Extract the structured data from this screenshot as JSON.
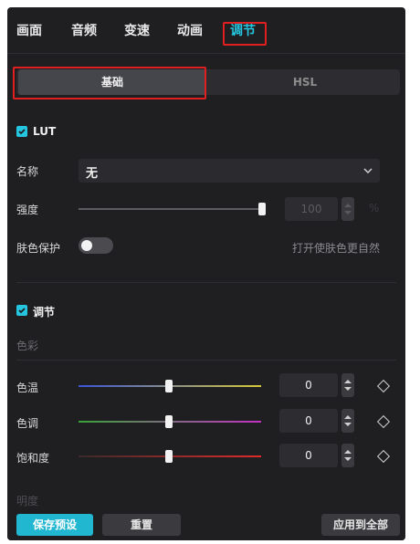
{
  "tabs": [
    {
      "label": "画面"
    },
    {
      "label": "音频"
    },
    {
      "label": "变速"
    },
    {
      "label": "动画"
    },
    {
      "label": "调节",
      "active": true
    }
  ],
  "subtabs": [
    {
      "label": "基础",
      "active": true
    },
    {
      "label": "HSL"
    }
  ],
  "lut": {
    "title": "LUT",
    "enabled": true,
    "name_label": "名称",
    "name_value": "无",
    "strength_label": "强度",
    "strength_value": "100",
    "strength_unit": "%",
    "strength_fraction": 1.0,
    "skin_protect_label": "肤色保护",
    "skin_protect_enabled": false,
    "skin_hint": "打开使肤色更自然"
  },
  "adjust": {
    "title": "调节",
    "enabled": true,
    "color_section": "色彩",
    "sliders": [
      {
        "label": "色温",
        "value": "0"
      },
      {
        "label": "色调",
        "value": "0"
      },
      {
        "label": "饱和度",
        "value": "0"
      }
    ],
    "next_section": "明度"
  },
  "footer": {
    "save_preset": "保存预设",
    "reset": "重置",
    "apply_all": "应用到全部"
  },
  "colors": {
    "accent": "#25c6e0",
    "highlight_box": "#e02020",
    "panel_bg": "#1f1f22"
  },
  "icons": [
    "check-icon",
    "chevron-down-icon",
    "keyframe-diamond-icon",
    "stepper-icon"
  ]
}
